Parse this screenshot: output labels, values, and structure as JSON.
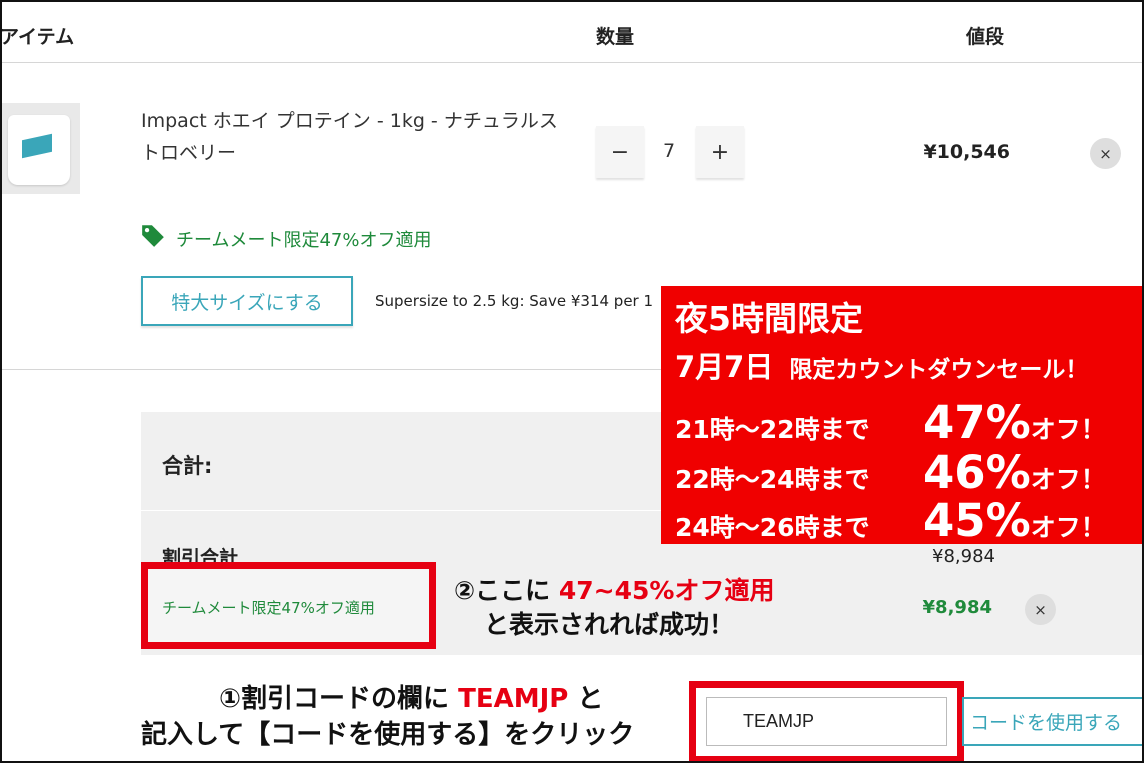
{
  "header": {
    "item_label": "アイテム",
    "qty_label": "数量",
    "price_label": "値段"
  },
  "product": {
    "name": "Impact ホエイ プロテイン - 1kg - ナチュラルストロベリー",
    "quantity": "7",
    "minus_label": "−",
    "plus_label": "+",
    "price": "¥10,546",
    "remove_label": "×",
    "promo_text": "チームメート限定47%オフ適用",
    "supersize_button": "特大サイズにする",
    "supersize_text": "Supersize to 2.5 kg: Save ¥314 per 1"
  },
  "summary": {
    "total_label": "合計:",
    "discount_label": "割引合計",
    "discount_total": "¥8,984",
    "discount_item_label": "チームメート限定47%オフ適用",
    "discount_item_value": "¥8,984",
    "remove_label": "×"
  },
  "coupon": {
    "input_value": "TEAMJP",
    "apply_button": "コードを使用する"
  },
  "banner": {
    "line1": "夜5時間限定",
    "date": "7月7日",
    "sale": "限定カウントダウンセール！",
    "rows": [
      {
        "time": "21時～22時まで",
        "percent": "47%",
        "off": "オフ！"
      },
      {
        "time": "22時～24時まで",
        "percent": "46%",
        "off": "オフ！"
      },
      {
        "time": "24時～26時まで",
        "percent": "45%",
        "off": "オフ！"
      }
    ]
  },
  "annotation_step2": {
    "prefix": "②ここに",
    "highlight": "47~45%オフ適用",
    "line2": "と表示されれば成功！"
  },
  "annotation_step1": {
    "line1_prefix": "①割引コードの欄に",
    "code": "TEAMJP",
    "line1_suffix": "と",
    "line2": "記入して【コードを使用する】をクリック"
  },
  "colors": {
    "accent": "#3aa6b9",
    "promo_green": "#1f8a3b",
    "annotation_red": "#e60012"
  },
  "icons": {
    "promo": "tag-icon",
    "remove": "close-icon"
  }
}
